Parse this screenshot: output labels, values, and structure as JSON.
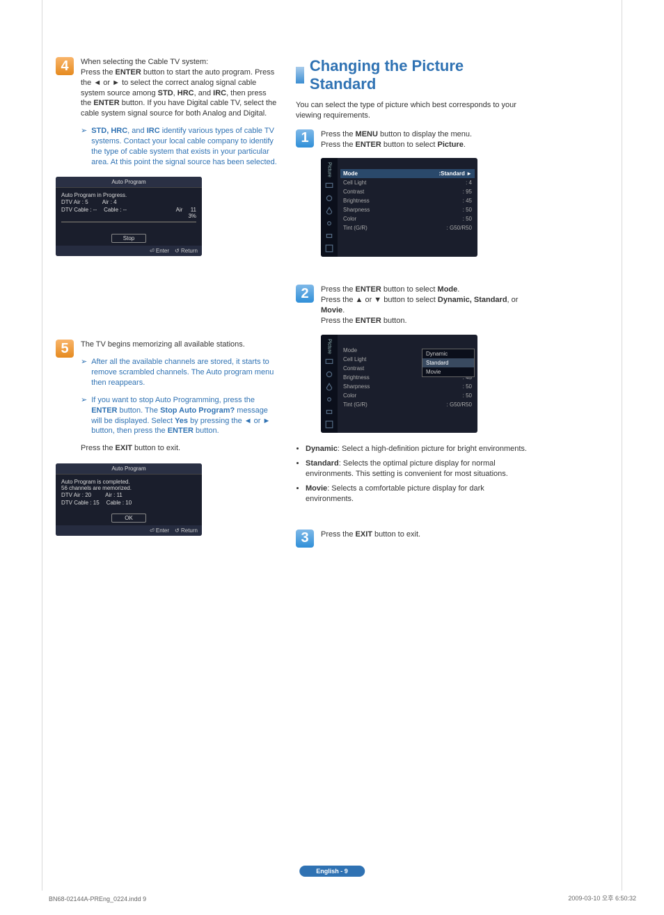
{
  "left": {
    "step4": {
      "num": "4",
      "p1a": "When selecting the Cable TV system:",
      "p1b_1": "Press the ",
      "p1b_enter": "ENTER",
      "p1b_2": " button to start the auto program. Press the ◄ or ► to select the correct analog signal cable system source among ",
      "p1b_std": "STD",
      "p1b_c1": ", ",
      "p1b_hrc": "HRC",
      "p1b_c2": ", and ",
      "p1b_irc": "IRC",
      "p1b_3": ", then press the ",
      "p1b_enter2": "ENTER",
      "p1b_4": " button. If you have Digital cable TV, select the cable system signal source for both Analog and Digital.",
      "note_1": "STD, HRC",
      "note_2": ", and ",
      "note_3": "IRC",
      "note_4": " identify various types of cable TV systems. Contact your local cable company to identify the type of cable system that exists in your particular area. At this point the signal source has been selected."
    },
    "osd1": {
      "title": "Auto Program",
      "line1": "Auto Program in Progress.",
      "c1a": "DTV Air : 5",
      "c1b": "Air : 4",
      "c2a": "DTV Cable : --",
      "c2b": "Cable : --",
      "mid1": "Air",
      "mid2a": "11",
      "mid2b": "3%",
      "btn": "Stop",
      "foot_enter": "Enter",
      "foot_return": "Return"
    },
    "step5": {
      "num": "5",
      "p1": "The TV begins memorizing all available stations.",
      "n1": "After all the available channels are stored, it starts to remove scrambled channels. The Auto program menu then reappears.",
      "n2_1": "If you want to stop Auto Programming, press the ",
      "n2_enter": "ENTER",
      "n2_2": " button.  The ",
      "n2_stop": "Stop Auto Program?",
      "n2_3": " message will be displayed. Select ",
      "n2_yes": "Yes",
      "n2_4": " by pressing the ◄ or ► button, then press the ",
      "n2_enter2": "ENTER",
      "n2_5": " button.",
      "exit_1": "Press the ",
      "exit_b": "EXIT",
      "exit_2": " button to exit."
    },
    "osd2": {
      "title": "Auto Program",
      "l1": "Auto Program is completed.",
      "l2": "56 channels are memorized.",
      "c1a": "DTV Air : 20",
      "c1b": "Air : 11",
      "c2a": "DTV Cable : 15",
      "c2b": "Cable : 10",
      "btn": "OK",
      "foot_enter": "Enter",
      "foot_return": "Return"
    }
  },
  "right": {
    "heading": "Changing the Picture Standard",
    "intro": "You can select the type of picture which best corresponds to your viewing requirements.",
    "step1": {
      "num": "1",
      "l1_1": "Press the ",
      "l1_b": "MENU",
      "l1_2": " button to display the menu.",
      "l2_1": "Press the ",
      "l2_b": "ENTER",
      "l2_2": " button to select ",
      "l2_p": "Picture",
      "l2_3": "."
    },
    "menu1": {
      "side": "Picture",
      "rows": [
        {
          "k": "Mode",
          "v": ":Standard   ►",
          "sel": true
        },
        {
          "k": "Cell Light",
          "v": ": 4"
        },
        {
          "k": "Contrast",
          "v": ": 95"
        },
        {
          "k": "Brightness",
          "v": ": 45"
        },
        {
          "k": "Sharpness",
          "v": ": 50"
        },
        {
          "k": "Color",
          "v": ": 50"
        },
        {
          "k": "Tint (G/R)",
          "v": ": G50/R50"
        }
      ]
    },
    "step2": {
      "num": "2",
      "l1_1": "Press the ",
      "l1_b": "ENTER",
      "l1_2": " button to select ",
      "l1_m": "Mode",
      "l1_3": ".",
      "l2_1": "Press the ▲ or ▼ button to select ",
      "l2_d": "Dynamic, Standard",
      "l2_2": ", or ",
      "l2_mv": "Movie",
      "l2_3": ".",
      "l3_1": "Press the ",
      "l3_b": "ENTER",
      "l3_2": " button."
    },
    "menu2": {
      "side": "Picture",
      "popup": {
        "o1": "Dynamic",
        "o2": "Standard",
        "o3": "Movie"
      },
      "rows": [
        {
          "k": "Mode",
          "v": ""
        },
        {
          "k": "Cell Light",
          "v": ":"
        },
        {
          "k": "Contrast",
          "v": ":"
        },
        {
          "k": "Brightness",
          "v": ": 45"
        },
        {
          "k": "Sharpness",
          "v": ": 50"
        },
        {
          "k": "Color",
          "v": ": 50"
        },
        {
          "k": "Tint (G/R)",
          "v": ": G50/R50"
        }
      ]
    },
    "desc": {
      "d1a": "Dynamic",
      "d1b": ": Select a high-definition picture for bright environments.",
      "d2a": "Standard",
      "d2b": ": Selects the optimal picture display for normal environments. This setting is convenient for most situations.",
      "d3a": "Movie",
      "d3b": ": Selects a comfortable picture display for dark environments."
    },
    "step3": {
      "num": "3",
      "l_1": "Press the ",
      "l_b": "EXIT",
      "l_2": " button to exit."
    }
  },
  "badge": "English - 9",
  "footL": "BN68-02144A-PREng_0224.indd   9",
  "footR": "2009-03-10   오후 6:50:32"
}
